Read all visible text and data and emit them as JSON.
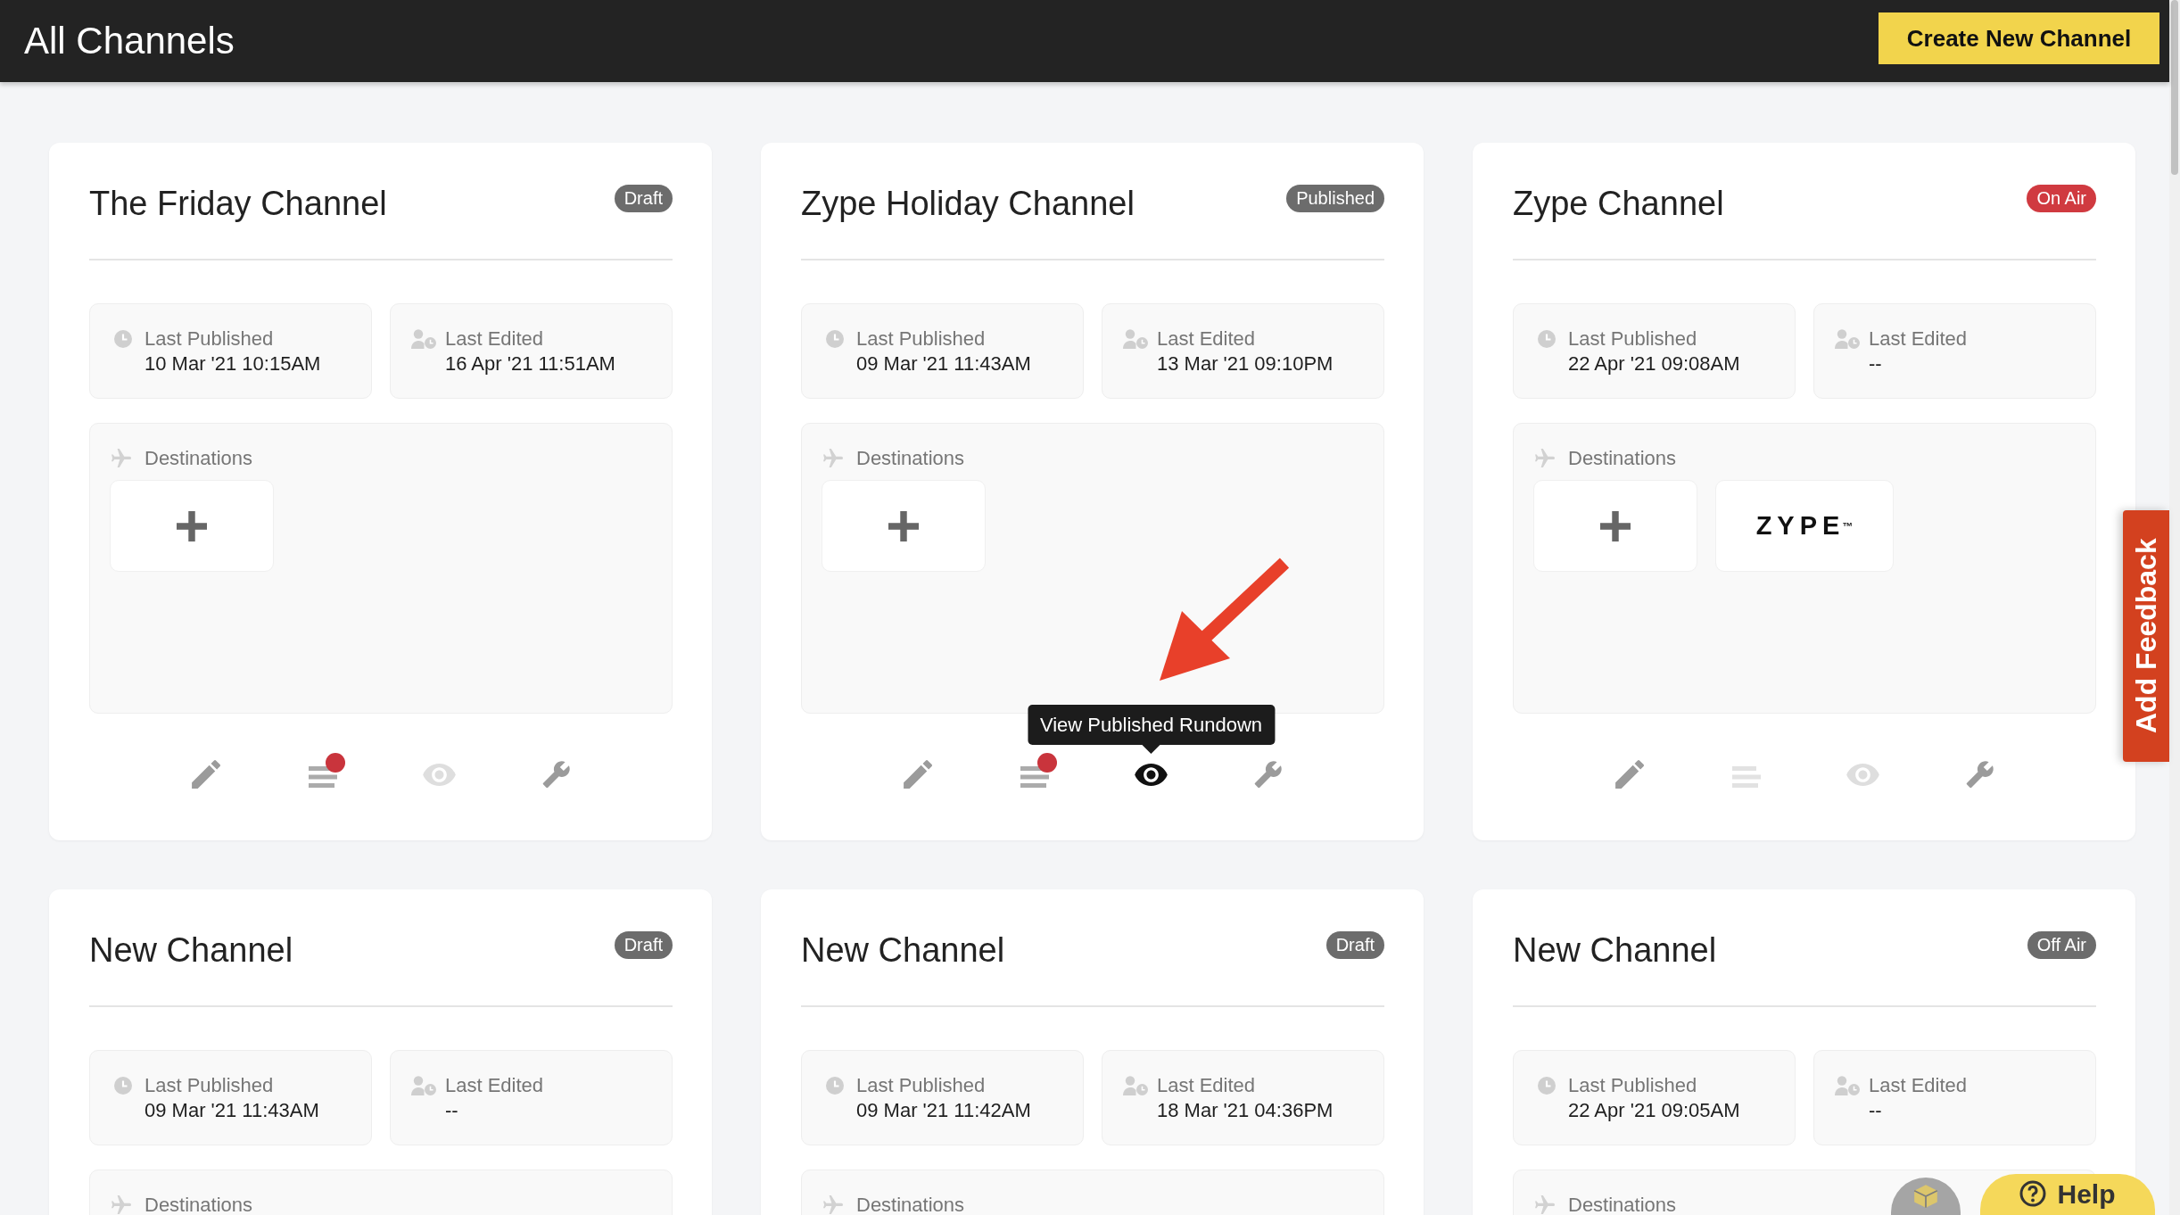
{
  "header": {
    "title": "All Channels",
    "create_button": "Create New Channel"
  },
  "cards": [
    {
      "title": "The Friday Channel",
      "status": {
        "label": "Draft",
        "color": "#6c6c6c"
      },
      "last_published": {
        "label": "Last Published",
        "value": "10 Mar '21 10:15AM"
      },
      "last_edited": {
        "label": "Last Edited",
        "value": "16 Apr '21 11:51AM"
      },
      "destinations": {
        "label": "Destinations",
        "tiles": [
          {
            "kind": "add"
          }
        ]
      },
      "actions": [
        {
          "kind": "edit",
          "disabled": false,
          "hovered": false,
          "alert": false
        },
        {
          "kind": "rundown",
          "disabled": false,
          "hovered": false,
          "alert": true
        },
        {
          "kind": "view",
          "disabled": true,
          "hovered": false,
          "alert": false
        },
        {
          "kind": "settings",
          "disabled": false,
          "hovered": false,
          "alert": false
        }
      ]
    },
    {
      "title": "Zype Holiday Channel",
      "status": {
        "label": "Published",
        "color": "#6c6c6c"
      },
      "last_published": {
        "label": "Last Published",
        "value": "09 Mar '21 11:43AM"
      },
      "last_edited": {
        "label": "Last Edited",
        "value": "13 Mar '21 09:10PM"
      },
      "destinations": {
        "label": "Destinations",
        "tiles": [
          {
            "kind": "add"
          }
        ]
      },
      "actions": [
        {
          "kind": "edit",
          "disabled": false,
          "hovered": false,
          "alert": false
        },
        {
          "kind": "rundown",
          "disabled": false,
          "hovered": false,
          "alert": true
        },
        {
          "kind": "view",
          "disabled": false,
          "hovered": true,
          "alert": false,
          "tooltip": "View Published Rundown"
        },
        {
          "kind": "settings",
          "disabled": false,
          "hovered": false,
          "alert": false
        }
      ]
    },
    {
      "title": "Zype Channel",
      "status": {
        "label": "On Air",
        "color": "#d03a40"
      },
      "last_published": {
        "label": "Last Published",
        "value": "22 Apr '21 09:08AM"
      },
      "last_edited": {
        "label": "Last Edited",
        "value": "--"
      },
      "destinations": {
        "label": "Destinations",
        "tiles": [
          {
            "kind": "add"
          },
          {
            "kind": "logo",
            "text": "ZYPE$^{™}$"
          }
        ]
      },
      "actions": [
        {
          "kind": "edit",
          "disabled": false,
          "hovered": false,
          "alert": false
        },
        {
          "kind": "rundown",
          "disabled": true,
          "hovered": false,
          "alert": false
        },
        {
          "kind": "view",
          "disabled": true,
          "hovered": false,
          "alert": false
        },
        {
          "kind": "settings",
          "disabled": false,
          "hovered": false,
          "alert": false
        }
      ]
    },
    {
      "title": "New Channel",
      "status": {
        "label": "Draft",
        "color": "#6c6c6c"
      },
      "last_published": {
        "label": "Last Published",
        "value": "09 Mar '21 11:43AM"
      },
      "last_edited": {
        "label": "Last Edited",
        "value": "--"
      },
      "destinations": {
        "label": "Destinations"
      }
    },
    {
      "title": "New Channel",
      "status": {
        "label": "Draft",
        "color": "#6c6c6c"
      },
      "last_published": {
        "label": "Last Published",
        "value": "09 Mar '21 11:42AM"
      },
      "last_edited": {
        "label": "Last Edited",
        "value": "18 Mar '21 04:36PM"
      },
      "destinations": {
        "label": "Destinations"
      }
    },
    {
      "title": "New Channel",
      "status": {
        "label": "Off Air",
        "color": "#6c6c6c"
      },
      "last_published": {
        "label": "Last Published",
        "value": "22 Apr '21 09:05AM"
      },
      "last_edited": {
        "label": "Last Edited",
        "value": "--"
      },
      "destinations": {
        "label": "Destinations"
      }
    }
  ],
  "feedback_tab": "Add Feedback",
  "help_button": "Help"
}
